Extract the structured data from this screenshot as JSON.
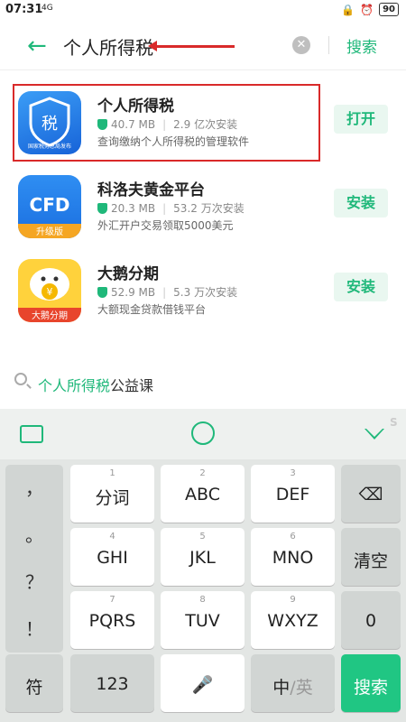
{
  "status_bar": {
    "time": "07:31",
    "network": "4G",
    "battery": "90"
  },
  "search": {
    "query": "个人所得税",
    "submit_label": "搜索"
  },
  "results": [
    {
      "name": "个人所得税",
      "size": "40.7 MB",
      "installs": "2.9 亿次安装",
      "desc": "查询缴纳个人所得税的管理软件",
      "button": "打开",
      "icon_text": "税",
      "icon_caption": "国家税务总局\n发布",
      "icon": "tax-shield-icon"
    },
    {
      "name": "科洛夫黄金平台",
      "size": "20.3 MB",
      "installs": "53.2 万次安装",
      "desc": "外汇开户交易领取5000美元",
      "button": "安装",
      "icon_text": "CFD",
      "icon_caption": "升级版",
      "icon": "cfd-icon"
    },
    {
      "name": "大鹅分期",
      "size": "52.9 MB",
      "installs": "5.3 万次安装",
      "desc": "大额现金贷款借钱平台",
      "button": "安装",
      "icon_text": "¥",
      "icon_caption": "大鹅分期",
      "icon": "goose-icon"
    }
  ],
  "suggestion": {
    "highlight": "个人所得税",
    "rest": "公益课"
  },
  "keyboard": {
    "punctuation": [
      "，",
      "。",
      "？",
      "！"
    ],
    "rows": [
      [
        {
          "num": "1",
          "label": "分词"
        },
        {
          "num": "2",
          "label": "ABC"
        },
        {
          "num": "3",
          "label": "DEF"
        }
      ],
      [
        {
          "num": "4",
          "label": "GHI"
        },
        {
          "num": "5",
          "label": "JKL"
        },
        {
          "num": "6",
          "label": "MNO"
        }
      ],
      [
        {
          "num": "7",
          "label": "PQRS"
        },
        {
          "num": "8",
          "label": "TUV"
        },
        {
          "num": "9",
          "label": "WXYZ"
        }
      ]
    ],
    "right_keys": [
      "清空",
      "0"
    ],
    "bottom": {
      "symbol": "符",
      "numbers": "123",
      "lang_active": "中",
      "lang_inactive": "英",
      "submit": "搜索"
    }
  },
  "colors": {
    "accent": "#1fb87a",
    "highlight_box": "#d92a2a"
  }
}
